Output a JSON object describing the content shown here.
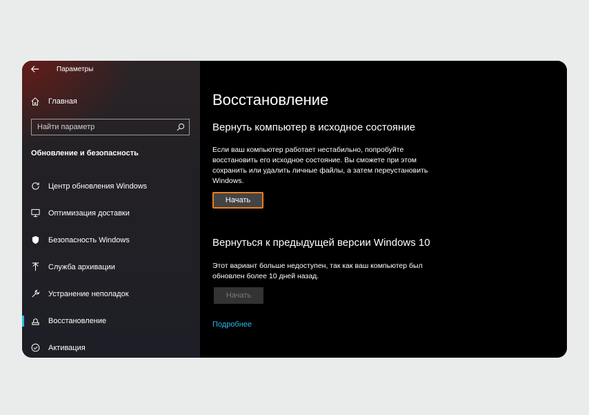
{
  "app": {
    "title": "Параметры"
  },
  "sidebar": {
    "home_label": "Главная",
    "search_placeholder": "Найти параметр",
    "section_title": "Обновление и безопасность",
    "items": [
      {
        "label": "Центр обновления Windows",
        "icon": "refresh-icon"
      },
      {
        "label": "Оптимизация доставки",
        "icon": "delivery-icon"
      },
      {
        "label": "Безопасность Windows",
        "icon": "shield-icon"
      },
      {
        "label": "Служба архивации",
        "icon": "backup-arrow-icon"
      },
      {
        "label": "Устранение неполадок",
        "icon": "wrench-icon"
      },
      {
        "label": "Восстановление",
        "icon": "recovery-icon",
        "active": true
      },
      {
        "label": "Активация",
        "icon": "check-circle-icon"
      }
    ]
  },
  "main": {
    "title": "Восстановление",
    "reset": {
      "heading": "Вернуть компьютер в исходное состояние",
      "description": "Если ваш компьютер работает нестабильно, попробуйте восстановить его исходное состояние. Вы сможете при этом сохранить или удалить личные файлы, а затем переустановить Windows.",
      "button": "Начать"
    },
    "rollback": {
      "heading": "Вернуться к предыдущей версии Windows 10",
      "description": "Этот вариант больше недоступен, так как ваш компьютер был обновлен более 10 дней назад.",
      "button": "Начать"
    },
    "more_link": "Подробнее"
  },
  "colors": {
    "accent": "#2bb8e6",
    "highlight": "#f07d1f"
  }
}
